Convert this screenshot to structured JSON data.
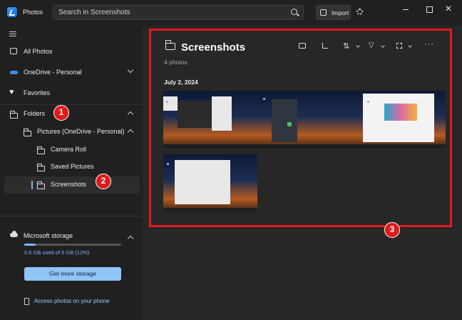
{
  "window": {
    "app_title": "Photos"
  },
  "titlebar": {
    "search_placeholder": "Search in Screenshots",
    "import_label": "Import"
  },
  "sidebar": {
    "all_photos": "All Photos",
    "onedrive": "OneDrive - Personal",
    "favorites": "Favorites",
    "folders": "Folders",
    "pictures_onedrive": "Pictures (OneDrive - Personal)",
    "camera_roll": "Camera Roll",
    "saved_pictures": "Saved Pictures",
    "screenshots": "Screenshots",
    "storage": {
      "title": "Microsoft storage",
      "usage_text": "0.6 GB used of 5 GB (12%)",
      "used_fraction": 0.12,
      "button_label": "Get more storage"
    },
    "phone_link": "Access photos on your phone"
  },
  "main": {
    "title": "Screenshots",
    "subtitle": "4 photos",
    "date_group": "July 2, 2024",
    "photo_count": 4
  },
  "annotations": {
    "badge1": "1",
    "badge2": "2",
    "badge3": "3",
    "highlight_color": "#e01b1b"
  },
  "colors": {
    "accent": "#7bb9ff",
    "button": "#8fc4f7",
    "background": "#202020"
  }
}
